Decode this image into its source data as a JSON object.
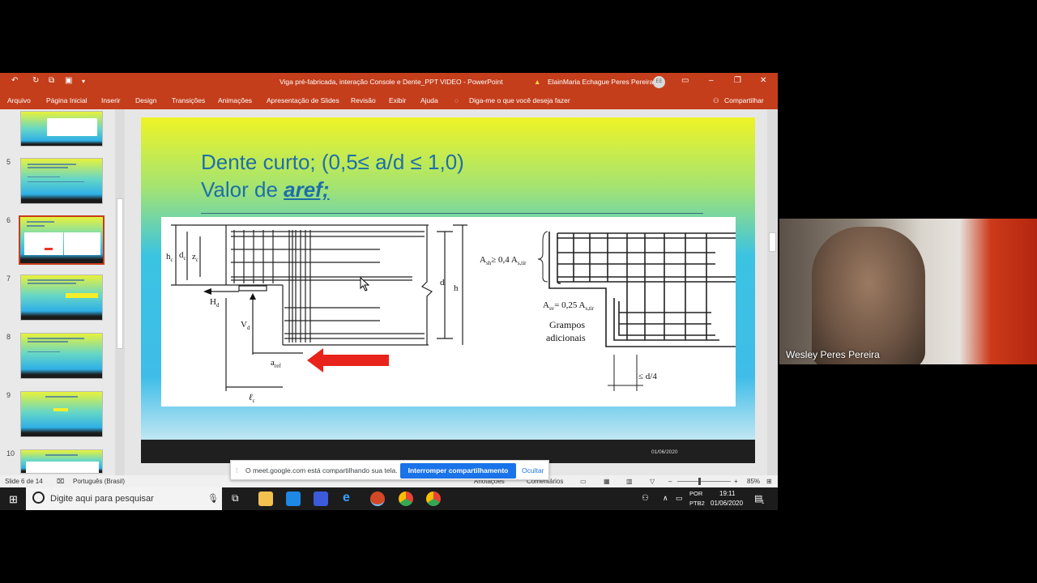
{
  "window": {
    "title": "Viga pré-fabricada, interação Console e Dente_PPT VIDEO  -  PowerPoint",
    "user": "ElainMaria Echague Peres Pereira",
    "user_initials": "EE"
  },
  "ribbon": {
    "tabs": [
      "Arquivo",
      "Página Inicial",
      "Inserir",
      "Design",
      "Transições",
      "Animações",
      "Apresentação de Slides",
      "Revisão",
      "Exibir",
      "Ajuda"
    ],
    "tell_me": "Diga-me o que você deseja fazer",
    "share": "Compartilhar"
  },
  "thumbnails": {
    "numbers": [
      "5",
      "6",
      "7",
      "8",
      "9",
      "10"
    ],
    "selected": "6"
  },
  "slide": {
    "title_line1": "Dente curto; (0,5≤ a/d ≤ 1,0)",
    "title_line2_prefix": "Valor de ",
    "title_line2_emph": "aref;",
    "date": "01/06/2020",
    "fig_left": {
      "hc": "h",
      "hc_sub": "c",
      "dc": "d",
      "dc_sub": "c",
      "zc": "z",
      "zc_sub": "c",
      "Hd": "H",
      "Hd_sub": "d",
      "Vd": "V",
      "Vd_sub": "d",
      "aref": "a",
      "aref_sub": "ref",
      "lc": "ℓ",
      "lc_sub": "c",
      "d": "d",
      "h": "h"
    },
    "fig_right": {
      "ash": "A",
      "ash_sub": "sh",
      "ash_rel": "≥ 0,4 A",
      "ash_rel_sub": "s,tir",
      "asv": "A",
      "asv_sub": "sv",
      "asv_rel": "= 0,25 A",
      "asv_rel_sub": "s,tir",
      "grampos1": "Grampos",
      "grampos2": "adicionais",
      "d4": "≤ d/4"
    }
  },
  "status": {
    "slide_of": "Slide 6 de 14",
    "language": "Português (Brasil)",
    "notes": "Anotações",
    "comments": "Comentários",
    "zoom": "85%"
  },
  "share_banner": {
    "message": "O meet.google.com está compartilhando sua tela.",
    "stop": "Interromper compartilhamento",
    "hide": "Ocultar"
  },
  "taskbar": {
    "search_placeholder": "Digite aqui para pesquisar",
    "lang1": "POR",
    "lang2": "PTB2",
    "time": "19:11",
    "date": "01/06/2020",
    "notif": "1"
  },
  "webcam": {
    "name": "Wesley Peres Pereira"
  },
  "colors": {
    "ppt_accent": "#c43e1c",
    "title_blue": "#1d6fa8",
    "meet_blue": "#1a73e8"
  }
}
